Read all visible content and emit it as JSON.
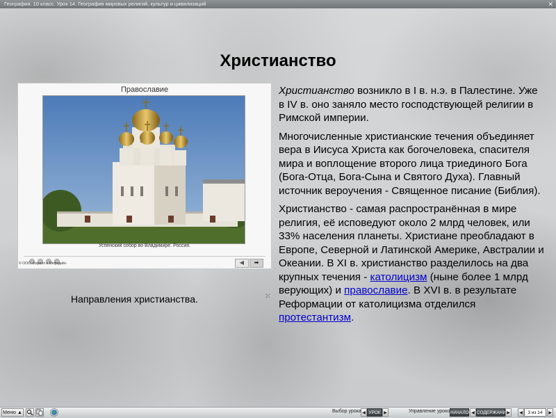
{
  "window": {
    "title": "География. 10 класс. Урок 14. География мировых религий, культур и цивилизаций",
    "close_glyph": "✕"
  },
  "slide": {
    "heading": "Христианство",
    "player": {
      "title": "Православие",
      "caption": "Успенский собор во Владимире. Россия.",
      "copyright": "© ООО «Кирилл и Мефодий»",
      "prev_glyph": "◀",
      "next_glyph": "➡"
    },
    "directions_label": "Направления христианства.",
    "marker_glyph": "⁙",
    "paragraphs": {
      "p1": {
        "term": "Христианство",
        "rest": " возникло в I в. н.э. в Палестине. Уже в IV в. оно заняло место господствующей религии в Римской империи."
      },
      "p2": "Многочисленные христианские течения объединяет вера в Иисуса Христа как богочеловека, спасителя мира и воплощение второго лица триединого Бога (Бога-Отца, Бога-Сына и Святого Духа). Главный источник вероучения - Священное писание (Библия).",
      "p3": {
        "part1": "Христианство - самая распространённая в мире религия, её исповедуют около 2 млрд человек, или 33% населения планеты. Христиане преобладают в Европе, Северной и Латинской Америке, Австралии и Океании. В XI в. христианство разделилось на два крупных течения - ",
        "link1": "католицизм",
        "part2": " (ныне более 1 млрд верующих) и ",
        "link2": "православие",
        "part3": ". В XVI в. в результате Реформации от католицизма отделился ",
        "link3": "протестантизм",
        "part4": "."
      }
    }
  },
  "taskbar": {
    "menu_label": "Меню ▲",
    "lesson_select_label": "Выбор урока:",
    "lesson_button": "УРОК",
    "control_label": "Управление уроком:",
    "start_button": "НАЧАЛО",
    "contents_button": "СОДЕРЖАНИЕ",
    "counter": "3 из 14",
    "left_arrow": "◀",
    "right_arrow": "▶"
  }
}
